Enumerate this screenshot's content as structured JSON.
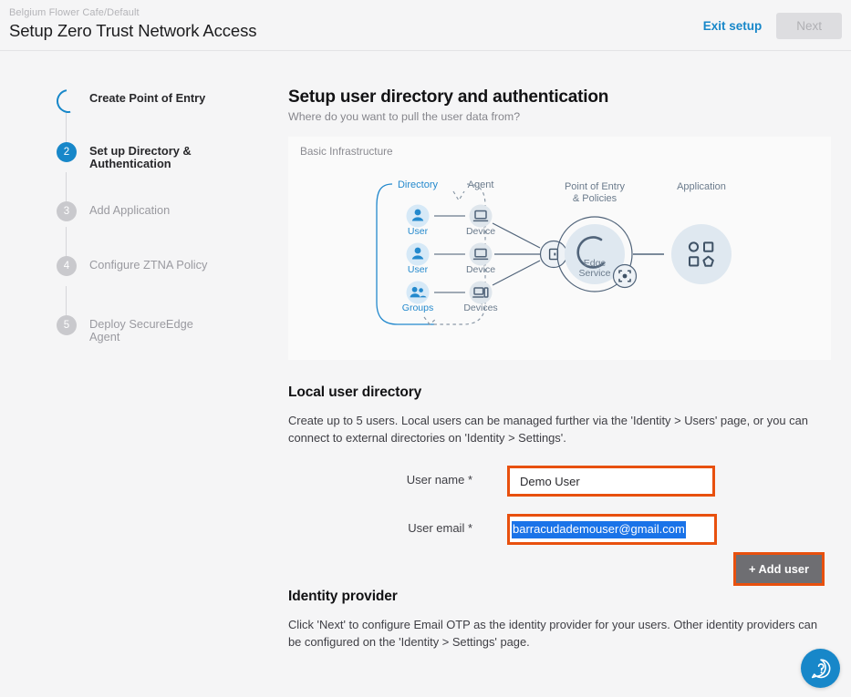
{
  "header": {
    "breadcrumb": "Belgium Flower Cafe/Default",
    "title": "Setup Zero Trust Network Access",
    "exit_label": "Exit setup",
    "next_label": "Next",
    "link_color": "#1787c9"
  },
  "stepper": {
    "steps": [
      {
        "num": "",
        "label": "Create Point of Entry",
        "state": "spinner"
      },
      {
        "num": "2",
        "label": "Set up Directory & Authentication",
        "state": "active"
      },
      {
        "num": "3",
        "label": "Add Application",
        "state": "idle"
      },
      {
        "num": "4",
        "label": "Configure ZTNA Policy",
        "state": "idle"
      },
      {
        "num": "5",
        "label": "Deploy SecureEdge Agent",
        "state": "idle"
      }
    ]
  },
  "main": {
    "title": "Setup user directory and authentication",
    "subtitle": "Where do you want to pull the user data from?"
  },
  "diagram": {
    "card_title": "Basic Infrastructure",
    "col_directory": "Directory",
    "col_agent": "Agent",
    "col_poe_line1": "Point of Entry",
    "col_poe_line2": "& Policies",
    "col_application": "Application",
    "row1_left": "User",
    "row1_right": "Device",
    "row2_left": "User",
    "row2_right": "Device",
    "row3_left": "Groups",
    "row3_right": "Devices",
    "edge_line1": "Edge",
    "edge_line2": "Service",
    "accent_blue": "#2389cd",
    "slate": "#5a6b7d"
  },
  "local_directory": {
    "heading": "Local user directory",
    "description": "Create up to 5 users. Local users can be managed further via the 'Identity > Users' page, or you can connect to external directories on 'Identity > Settings'.",
    "user_name_label": "User name *",
    "user_name_value": "Demo User",
    "user_name_placeholder": "",
    "user_email_label": "User email *",
    "user_email_value": "barracudademouser@gmail.com",
    "user_email_placeholder": "",
    "add_user_label": "+ Add user",
    "highlight_color": "#e8500e",
    "selection_color": "#1a73e8"
  },
  "identity_provider": {
    "heading": "Identity provider",
    "description": "Click 'Next' to configure Email OTP as the identity provider for your users. Other identity providers can be configured on the 'Identity > Settings' page."
  },
  "help": {
    "icon": "question-help-icon",
    "color": "#1787c9"
  }
}
